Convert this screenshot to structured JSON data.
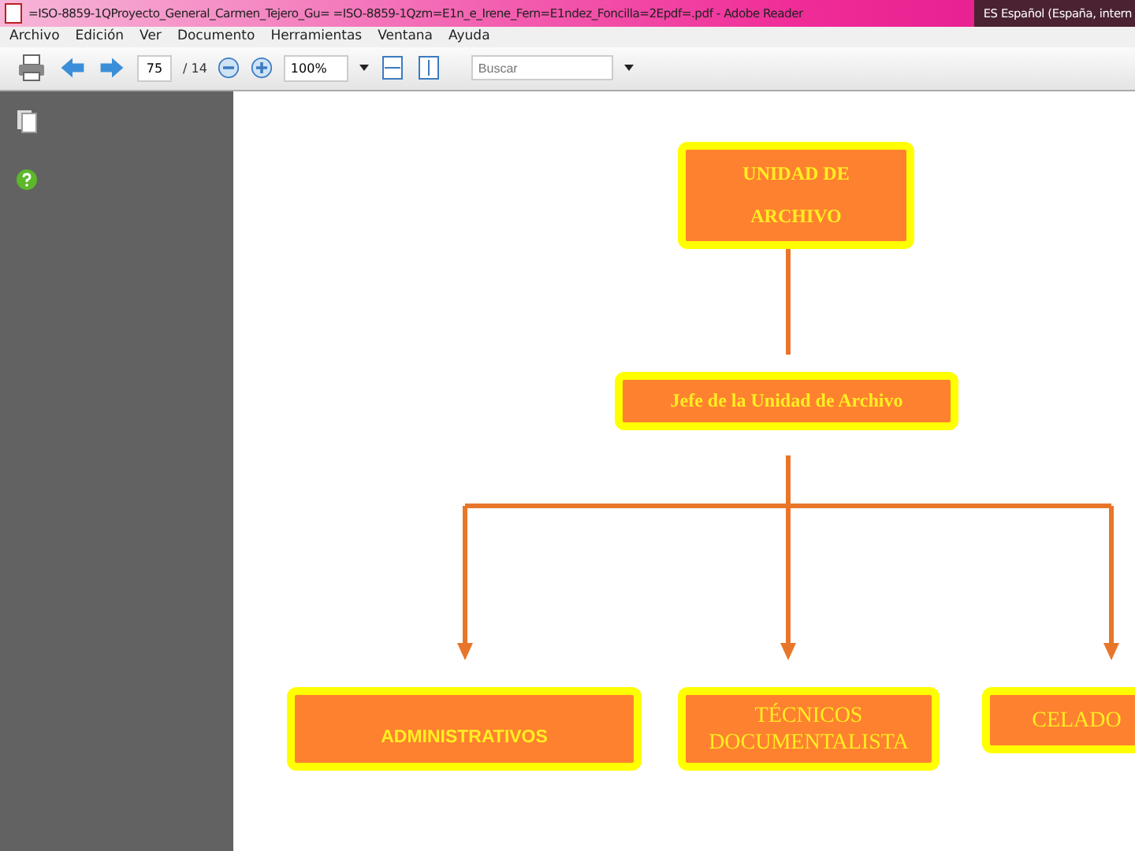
{
  "window": {
    "title": "=ISO-8859-1QProyecto_General_Carmen_Tejero_Gu= =ISO-8859-1Qzm=E1n_e_Irene_Fern=E1ndez_Foncilla=2Epdf=.pdf - Adobe Reader",
    "language": "ES Español (España, intern"
  },
  "menu": [
    "Archivo",
    "Edición",
    "Ver",
    "Documento",
    "Herramientas",
    "Ventana",
    "Ayuda"
  ],
  "toolbar": {
    "page": "75",
    "page_total": "/ 14",
    "zoom": "100%",
    "search": {
      "placeholder": "Buscar"
    }
  },
  "org_chart": {
    "nodes": [
      {
        "kind": "serif-bold",
        "lines": [
          "UNIDAD DE",
          "ARCHIVO"
        ]
      },
      {
        "kind": "serif-bold",
        "lines": [
          "Jefe de la Unidad de Archivo"
        ]
      },
      {
        "kind": "sans-bold",
        "lines": [
          "ADMINISTRATIVOS"
        ]
      },
      {
        "kind": "serif",
        "lines": [
          "TÉCNICOS",
          "DOCUMENTALISTA"
        ]
      },
      {
        "kind": "serif",
        "lines": [
          "CELADO"
        ]
      }
    ]
  }
}
